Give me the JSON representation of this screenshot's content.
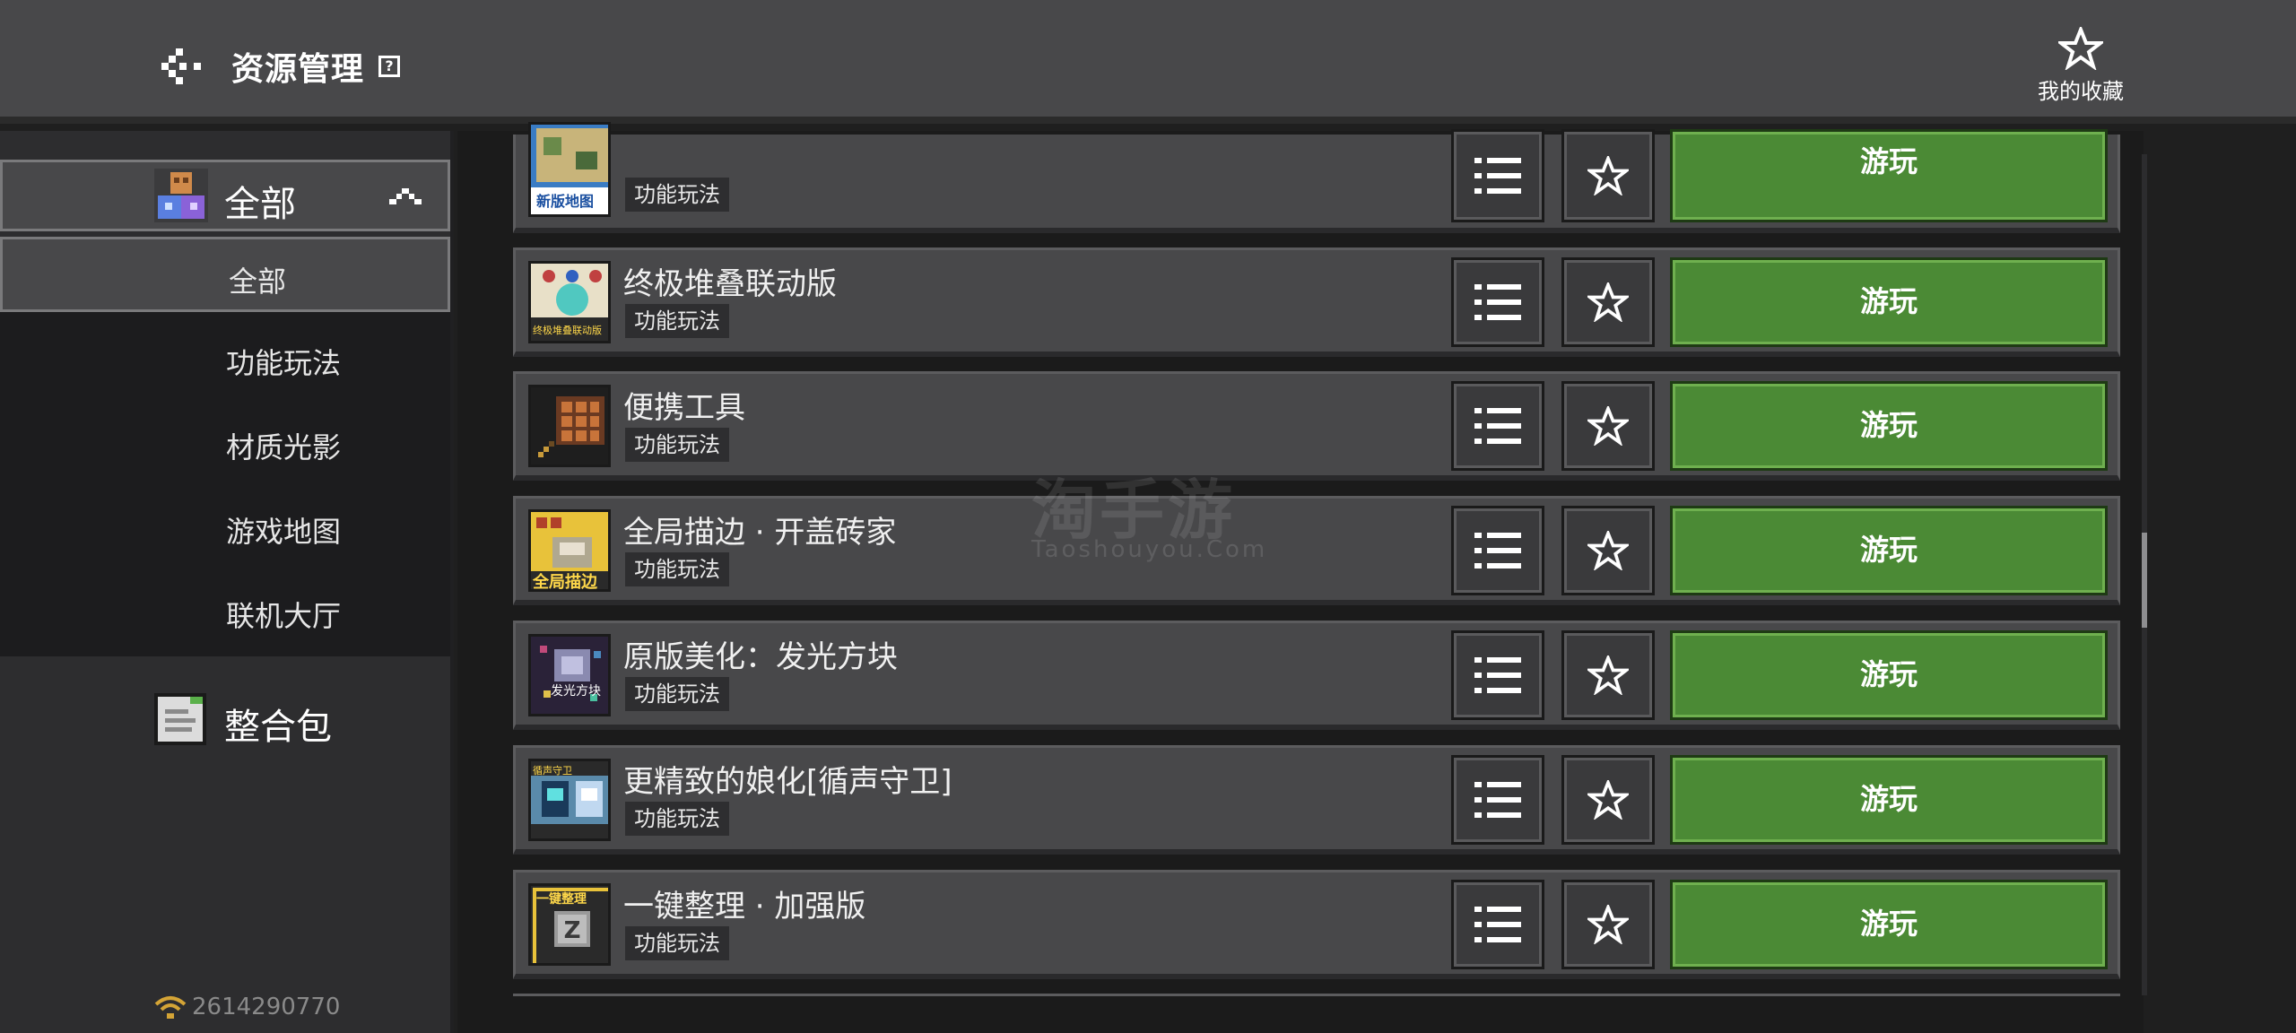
{
  "header": {
    "title": "资源管理",
    "help_glyph": "?",
    "favorites_label": "我的收藏"
  },
  "sidebar": {
    "category": {
      "label": "全部",
      "icon": "cube-icon"
    },
    "sub_items": [
      {
        "label": "全部",
        "active": true
      },
      {
        "label": "功能玩法",
        "active": false
      },
      {
        "label": "材质光影",
        "active": false
      },
      {
        "label": "游戏地图",
        "active": false
      },
      {
        "label": "联机大厅",
        "active": false
      }
    ],
    "pack": {
      "label": "整合包",
      "icon": "package-icon"
    },
    "user_id": "2614290770"
  },
  "list": {
    "play_label": "游玩",
    "items": [
      {
        "title": "",
        "tag": "功能玩法",
        "thumb_text": "新版地图"
      },
      {
        "title": "终极堆叠联动版",
        "tag": "功能玩法",
        "thumb_text": "终极堆叠联动版"
      },
      {
        "title": "便携工具",
        "tag": "功能玩法",
        "thumb_text": ""
      },
      {
        "title": "全局描边 · 开盖砖家",
        "tag": "功能玩法",
        "thumb_text": "全局描边"
      },
      {
        "title": "原版美化：发光方块",
        "tag": "功能玩法",
        "thumb_text": "发光方块"
      },
      {
        "title": "更精致的娘化[循声守卫]",
        "tag": "功能玩法",
        "thumb_text": "循声守卫"
      },
      {
        "title": "一键整理 · 加强版",
        "tag": "功能玩法",
        "thumb_text": "一键整理"
      }
    ]
  },
  "watermark": {
    "main": "淘手游",
    "sub": "Taoshouyou.Com"
  },
  "colors": {
    "play_green": "#4b8a35",
    "header_bg": "#48484a",
    "sidebar_bg": "#2d2d2f"
  }
}
